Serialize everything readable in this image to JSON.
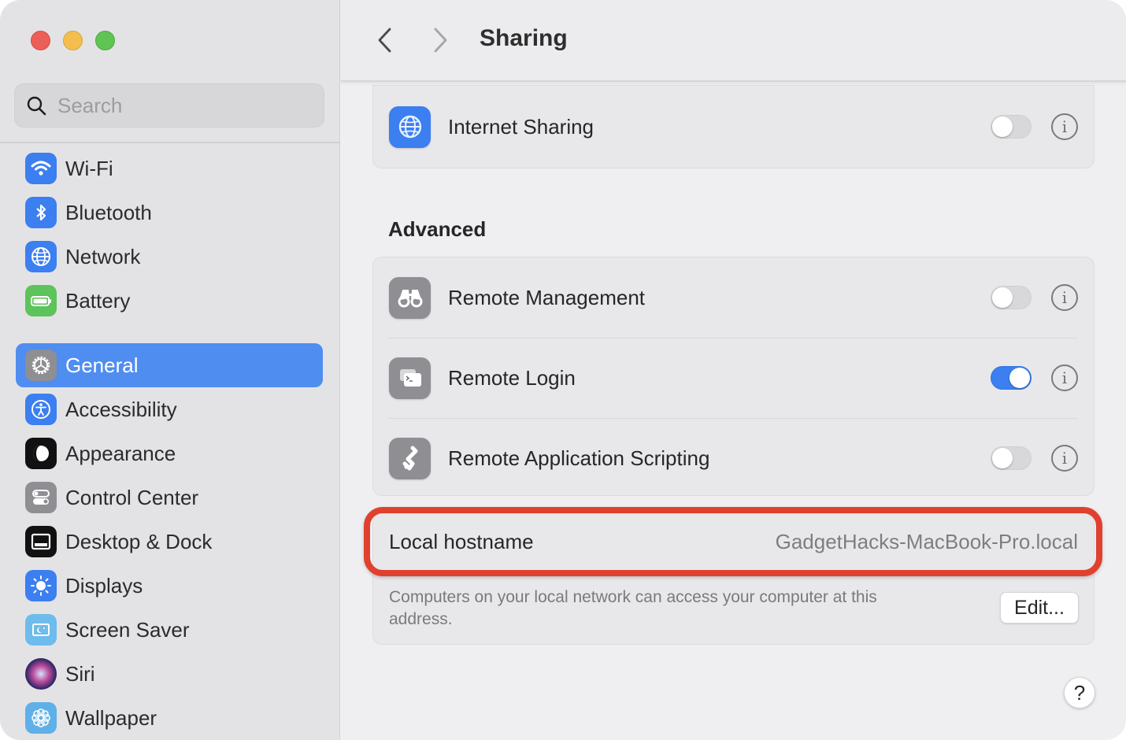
{
  "window": {
    "traffic_lights": [
      "close",
      "minimize",
      "zoom"
    ]
  },
  "sidebar": {
    "search": {
      "placeholder": "Search",
      "value": "",
      "icon": "magnifying-glass-icon"
    },
    "items": [
      {
        "label": "Wi-Fi",
        "icon": "wifi-icon",
        "color": "#3b7ff0",
        "selected": false
      },
      {
        "label": "Bluetooth",
        "icon": "bluetooth-icon",
        "color": "#3b7ff0",
        "selected": false
      },
      {
        "label": "Network",
        "icon": "globe-icon",
        "color": "#3b7ff0",
        "selected": false
      },
      {
        "label": "Battery",
        "icon": "battery-icon",
        "color": "#5cc45a",
        "selected": false
      },
      {
        "label": "General",
        "icon": "gear-icon",
        "color": "#8e8e93",
        "selected": true
      },
      {
        "label": "Accessibility",
        "icon": "accessibility-icon",
        "color": "#3b7ff0",
        "selected": false
      },
      {
        "label": "Appearance",
        "icon": "appearance-icon",
        "color": "#111111",
        "selected": false
      },
      {
        "label": "Control Center",
        "icon": "control-center-icon",
        "color": "#8e8e93",
        "selected": false
      },
      {
        "label": "Desktop & Dock",
        "icon": "desktop-dock-icon",
        "color": "#111111",
        "selected": false
      },
      {
        "label": "Displays",
        "icon": "sun-icon",
        "color": "#3b7ff0",
        "selected": false
      },
      {
        "label": "Screen Saver",
        "icon": "screen-saver-icon",
        "color": "#6ebcec",
        "selected": false
      },
      {
        "label": "Siri",
        "icon": "siri-icon",
        "color": "#2a2a3a",
        "selected": false
      },
      {
        "label": "Wallpaper",
        "icon": "wallpaper-flower-icon",
        "color": "#5fb0e8",
        "selected": false
      }
    ]
  },
  "toolbar": {
    "title": "Sharing",
    "back_icon": "chevron-left-icon",
    "forward_icon": "chevron-right-icon"
  },
  "sharing": {
    "top_card": [
      {
        "label": "Internet Sharing",
        "icon": "globe-icon",
        "enabled": false
      }
    ],
    "advanced_title": "Advanced",
    "advanced": [
      {
        "label": "Remote Management",
        "icon": "binoculars-icon",
        "enabled": false
      },
      {
        "label": "Remote Login",
        "icon": "terminal-icon",
        "enabled": true
      },
      {
        "label": "Remote Application Scripting",
        "icon": "script-icon",
        "enabled": false
      }
    ],
    "info_glyph": "i"
  },
  "hostname": {
    "label": "Local hostname",
    "value": "GadgetHacks-MacBook-Pro.local",
    "description": "Computers on your local network can access your computer at this address.",
    "edit_label": "Edit...",
    "highlight_color": "#e0412e"
  },
  "help": {
    "label": "?"
  },
  "colors": {
    "accent": "#3b7ff0",
    "selection": "#4f8df0",
    "sidebar_bg": "#e3e3e6",
    "content_bg": "#efeff1"
  }
}
